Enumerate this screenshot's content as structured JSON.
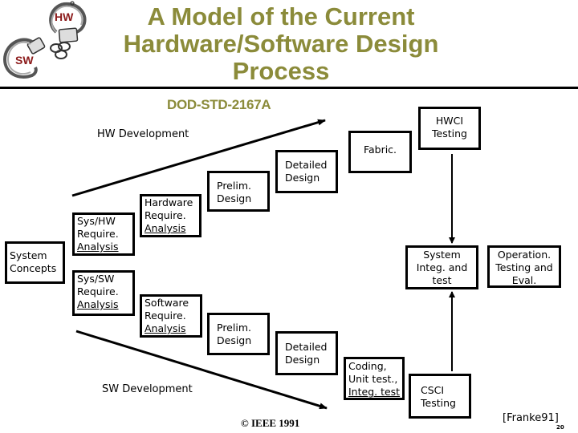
{
  "header": {
    "title_lines": [
      "A Model of the Current",
      "Hardware/Software Design",
      "Process"
    ],
    "subtitle": "DOD-STD-2167A",
    "logo": {
      "icon": "handcuffs-icon",
      "hw_label": "HW",
      "sw_label": "SW"
    }
  },
  "colors": {
    "title": "#8b8b3a",
    "logo_text": "#8b1a1a",
    "lines": "#000000"
  },
  "diagram": {
    "hw_track_label": "HW Development",
    "sw_track_label": "SW Development",
    "boxes": {
      "system_concepts": [
        "System",
        "Concepts"
      ],
      "sys_hw": [
        "Sys/HW",
        "Require.",
        "Analysis"
      ],
      "sys_sw": [
        "Sys/SW",
        "Require.",
        "Analysis"
      ],
      "hw_require": [
        "Hardware",
        "Require.",
        "Analysis"
      ],
      "sw_require": [
        "Software",
        "Require.",
        "Analysis"
      ],
      "hw_prelim": [
        "Prelim.",
        "Design"
      ],
      "sw_prelim": [
        "Prelim.",
        "Design"
      ],
      "hw_detailed": [
        "Detailed",
        "Design"
      ],
      "sw_detailed": [
        "Detailed",
        "Design"
      ],
      "fabric": [
        "Fabric."
      ],
      "coding": [
        "Coding,",
        "Unit test.,",
        "Integ. test"
      ],
      "hwci_testing": [
        "HWCI",
        "Testing"
      ],
      "csci_testing": [
        "CSCI",
        "Testing"
      ],
      "system_integ": [
        "System",
        "Integ. and",
        "test"
      ],
      "operation": [
        "Operation.",
        "Testing and",
        "Eval."
      ]
    }
  },
  "footer": {
    "copyright": "© IEEE 1991",
    "citation": "[Franke91]",
    "page_number": "20"
  }
}
